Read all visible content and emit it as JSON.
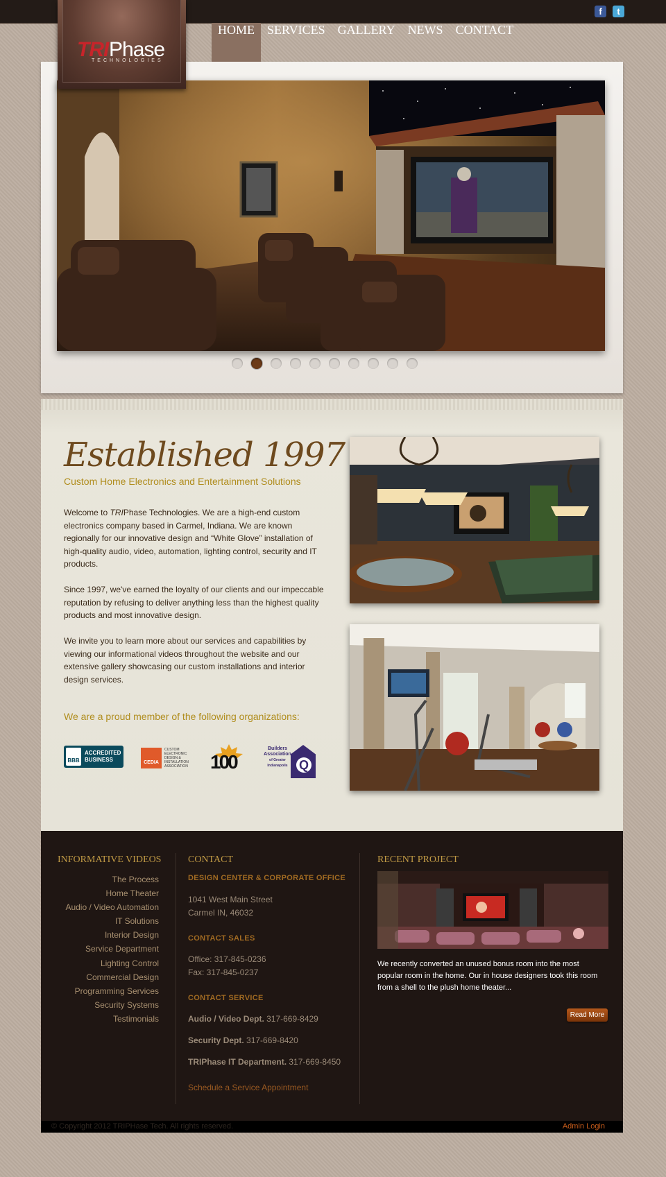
{
  "social": {
    "facebook": "f",
    "twitter": "t"
  },
  "logo": {
    "tri": "TRI",
    "phase": "Phase",
    "sub": "TECHNOLOGIES"
  },
  "nav": {
    "items": [
      "HOME",
      "SERVICES",
      "GALLERY",
      "NEWS",
      "CONTACT"
    ],
    "active": "HOME"
  },
  "slider": {
    "dot_count": 10,
    "active_dot": 2
  },
  "intro": {
    "heading": "Established 1997",
    "tagline": "Custom Home Electronics and Entertainment Solutions",
    "p1_pre": "Welcome to ",
    "p1_brand_italic": "TRI",
    "p1_post": "Phase Technologies. We are a high-end custom electronics company based in Carmel, Indiana. We are known regionally for our innovative design and “White Glove” installation of high-quality audio, video, automation, lighting control, security and IT products.",
    "p2": "Since 1997, we've earned the loyalty of our clients and our impeccable reputation by refusing to deliver anything less than the highest quality products and most innovative design.",
    "p3": "We invite you to learn more about our services and capabilities by viewing our informational videos throughout the website and our extensive gallery showcasing our custom installations and interior design services.",
    "member_heading": "We are a proud member of the following organizations:"
  },
  "badges": {
    "bbb_line1": "ACCREDITED",
    "bbb_line2": "BUSINESS",
    "bbb_logo": "BBB",
    "cedia_logo": "CEDIA",
    "cedia_text": "CUSTOM ELECTRONIC DESIGN & INSTALLATION ASSOCIATION",
    "hundred": "100",
    "builders_line1": "Builders",
    "builders_line2": "Association",
    "builders_line3": "of Greater Indianapolis",
    "builders_q": "Q"
  },
  "footer": {
    "videos_heading": "INFORMATIVE VIDEOS",
    "videos": [
      "The Process",
      "Home Theater",
      "Audio / Video Automation",
      "IT Solutions",
      "Interior Design",
      "Service Department",
      "Lighting Control",
      "Commercial Design",
      "Programming Services",
      "Security Systems",
      "Testimonials"
    ],
    "contact_heading": "CONTACT",
    "design_center_heading": "DESIGN CENTER & CORPORATE OFFICE",
    "address1": "1041 West Main Street",
    "address2": "Carmel IN, 46032",
    "sales_heading": "CONTACT SALES",
    "office": "Office: 317-845-0236",
    "fax": "Fax: 317-845-0237",
    "service_heading": "CONTACT SERVICE",
    "av_label": "Audio / Video Dept.",
    "av_phone": " 317-669-8429",
    "sec_label": "Security Dept.",
    "sec_phone": " 317-669-8420",
    "it_label": "TRIPhase IT Department.",
    "it_phone": " 317-669-8450",
    "schedule": "Schedule a Service Appointment",
    "recent_heading": "RECENT PROJECT",
    "recent_text": "We recently converted an unused bonus room into the most popular room in the home.  Our in house designers took this room from a shell to the plush home theater...",
    "read_more": "Read More"
  },
  "bottom": {
    "copyright": "© Copyright 2012 TRIPHase Tech. All rights reserved.",
    "admin": "Admin Login"
  }
}
